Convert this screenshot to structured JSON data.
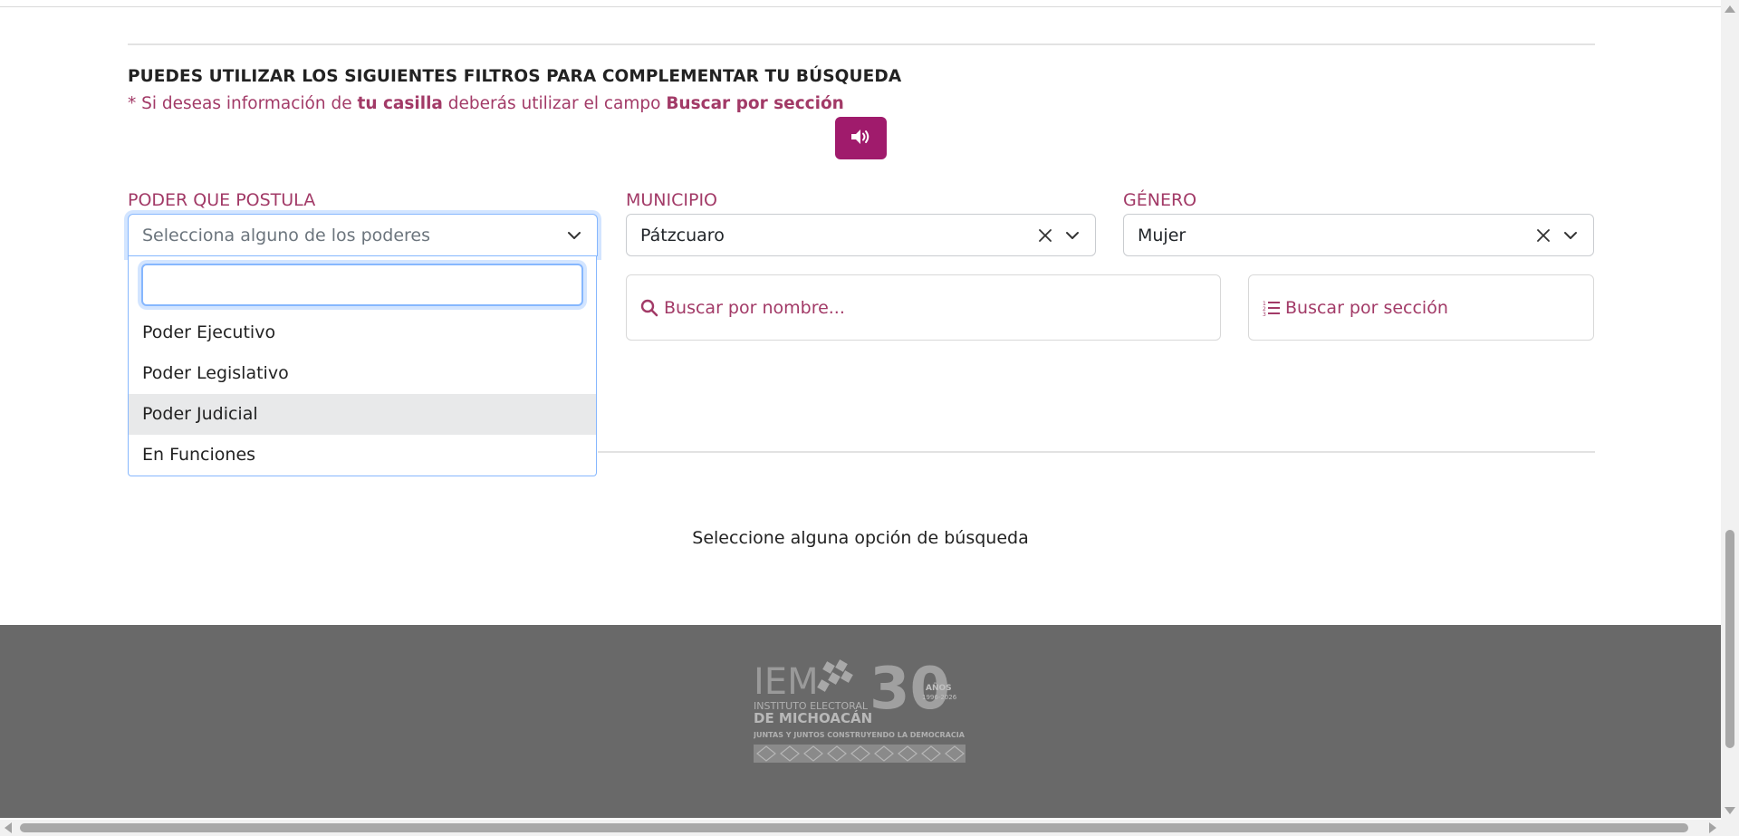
{
  "filters_section": {
    "heading": "PUEDES UTILIZAR LOS SIGUIENTES FILTROS PARA COMPLEMENTAR TU BÚSQUEDA",
    "note_prefix": "* Si deseas información de ",
    "note_bold_1": "tu casilla",
    "note_middle": " deberás utilizar el campo ",
    "note_bold_2": "Buscar por sección",
    "audio_button_icon": "volume-up-icon"
  },
  "poder": {
    "label": "PODER QUE POSTULA",
    "placeholder": "Selecciona alguno de los poderes",
    "search_value": "",
    "options": [
      "Poder Ejecutivo",
      "Poder Legislativo",
      "Poder Judicial",
      "En Funciones"
    ],
    "highlighted": "Poder Judicial"
  },
  "municipio": {
    "label": "MUNICIPIO",
    "value": "Pátzcuaro"
  },
  "genero": {
    "label": "GÉNERO",
    "value": "Mujer"
  },
  "search_name": {
    "placeholder": "Buscar por nombre...",
    "icon": "search-icon"
  },
  "search_section": {
    "placeholder": "Buscar por sección",
    "icon": "ordered-list-icon"
  },
  "status_message": "Seleccione alguna opción de búsqueda",
  "footer": {
    "logo_text_1": "IEM",
    "logo_text_2": "INSTITUTO ELECTORAL",
    "logo_text_3": "DE MICHOACÁN",
    "logo_text_4": "JUNTAS Y JUNTOS CONSTRUYENDO LA DEMOCRACIA",
    "logo_text_5": "AÑOS",
    "logo_text_6": "1996-2026",
    "logo_number": "30"
  },
  "colors": {
    "accent": "#a01b6c",
    "label_text": "#a23a67",
    "footer_bg": "#696969",
    "focus_border": "#86b7fe"
  }
}
